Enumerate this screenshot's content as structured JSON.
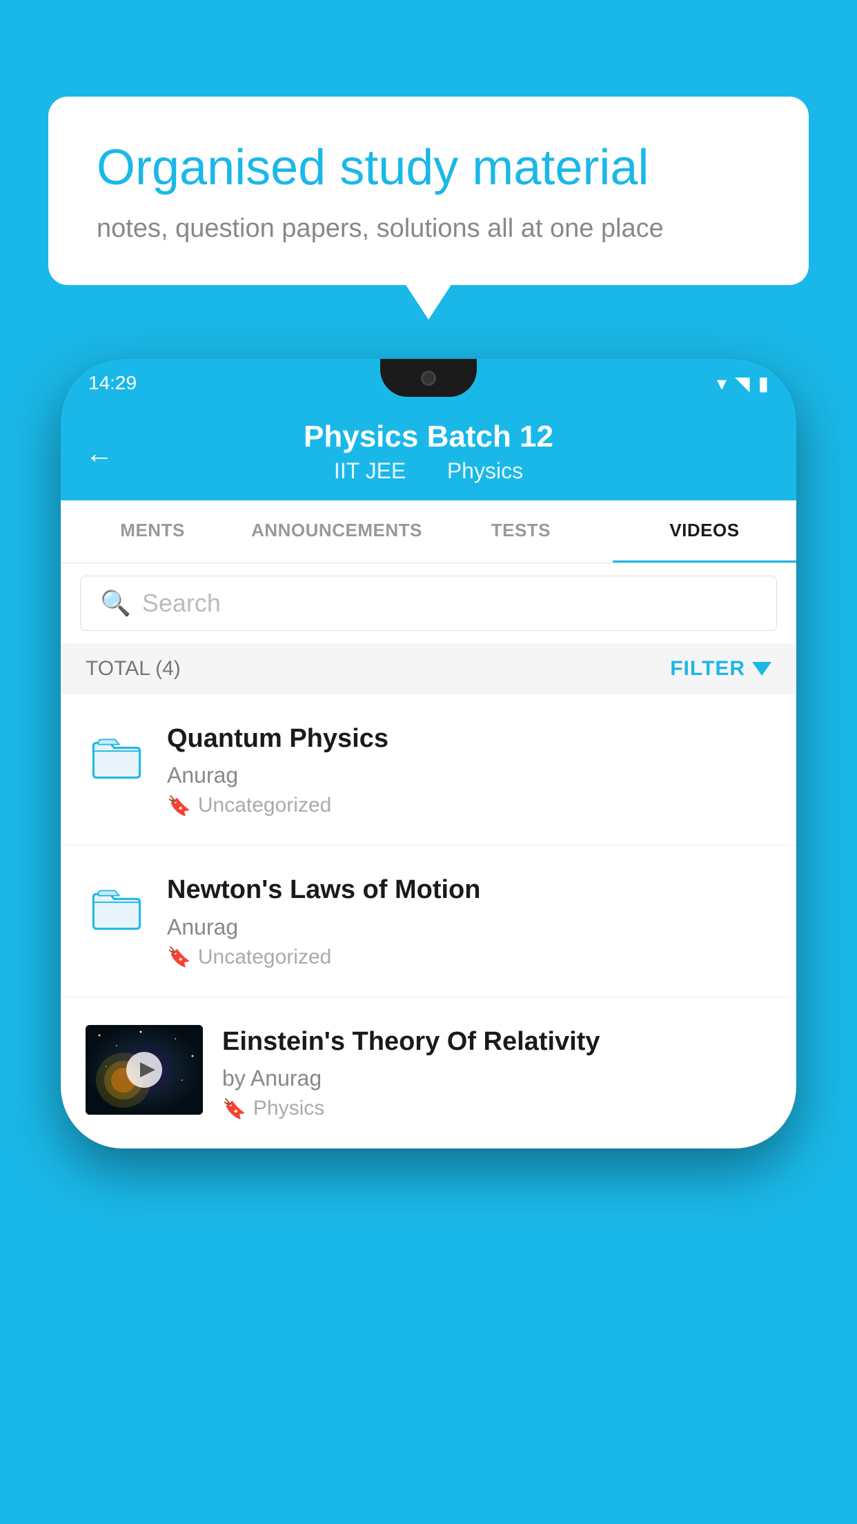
{
  "background_color": "#1ab8e8",
  "speech_bubble": {
    "title": "Organised study material",
    "subtitle": "notes, question papers, solutions all at one place"
  },
  "phone": {
    "status_bar": {
      "time": "14:29"
    },
    "header": {
      "back_label": "←",
      "title": "Physics Batch 12",
      "subtitle1": "IIT JEE",
      "subtitle2": "Physics"
    },
    "tabs": [
      {
        "label": "MENTS",
        "active": false
      },
      {
        "label": "ANNOUNCEMENTS",
        "active": false
      },
      {
        "label": "TESTS",
        "active": false
      },
      {
        "label": "VIDEOS",
        "active": true
      }
    ],
    "search": {
      "placeholder": "Search"
    },
    "filter_bar": {
      "total_label": "TOTAL (4)",
      "filter_label": "FILTER"
    },
    "videos": [
      {
        "id": 1,
        "title": "Quantum Physics",
        "author": "Anurag",
        "tag": "Uncategorized",
        "has_thumbnail": false
      },
      {
        "id": 2,
        "title": "Newton's Laws of Motion",
        "author": "Anurag",
        "tag": "Uncategorized",
        "has_thumbnail": false
      },
      {
        "id": 3,
        "title": "Einstein's Theory Of Relativity",
        "author": "by Anurag",
        "tag": "Physics",
        "has_thumbnail": true
      }
    ]
  }
}
